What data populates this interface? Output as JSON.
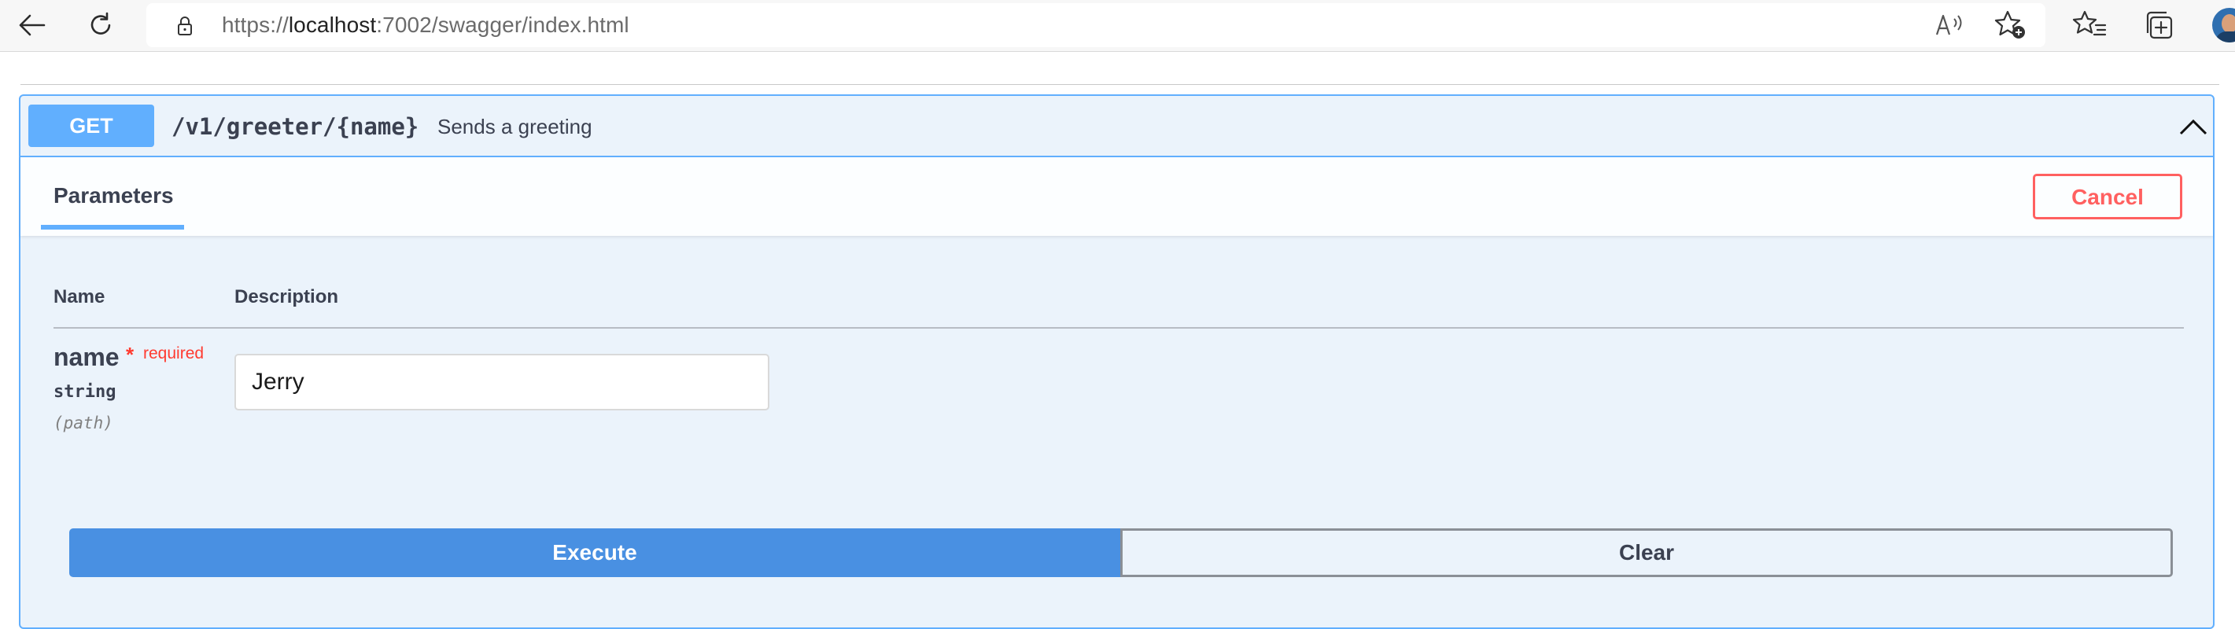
{
  "browser": {
    "url_prefix": "https://",
    "url_host": "localhost",
    "url_rest": ":7002/swagger/index.html"
  },
  "operation": {
    "method": "GET",
    "path": "/v1/greeter/{name}",
    "summary": "Sends a greeting",
    "accent_color": "#61affe"
  },
  "section": {
    "tab_label": "Parameters",
    "cancel_label": "Cancel"
  },
  "table": {
    "headers": [
      "Name",
      "Description"
    ]
  },
  "parameter": {
    "name": "name",
    "required_mark": "*",
    "required_label": "required",
    "type": "string",
    "in": "(path)",
    "value": "Jerry"
  },
  "actions": {
    "execute_label": "Execute",
    "clear_label": "Clear"
  }
}
